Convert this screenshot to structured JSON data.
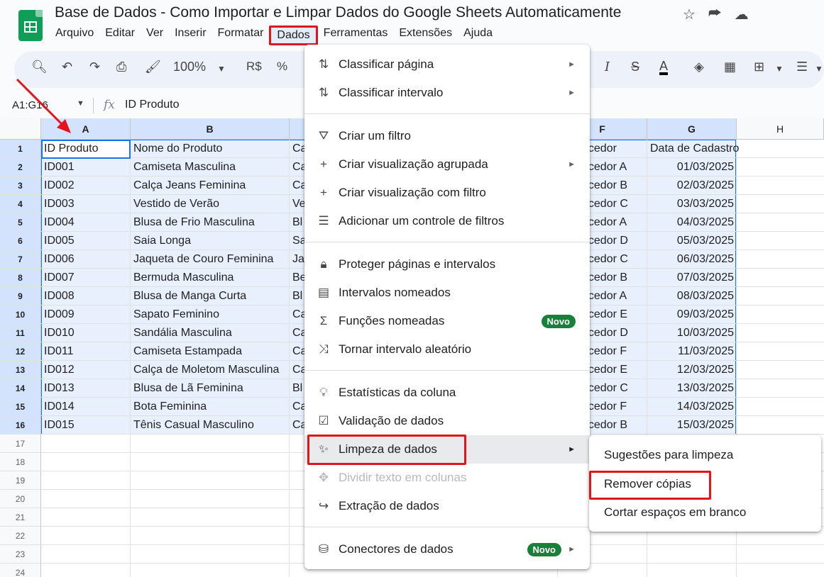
{
  "app": {
    "title": "Base de Dados - Como Importar e Limpar Dados do Google Sheets Automaticamente",
    "accent": "#0f9d58"
  },
  "menubar": [
    "Arquivo",
    "Editar",
    "Ver",
    "Inserir",
    "Formatar",
    "Dados",
    "Ferramentas",
    "Extensões",
    "Ajuda"
  ],
  "menubar_active": "Dados",
  "toolbar": {
    "zoom": "100%",
    "currency": "R$",
    "percent": "%"
  },
  "formula_bar": {
    "name_box": "A1:G16",
    "fx": "fx",
    "value": "ID Produto"
  },
  "columns": [
    "A",
    "B",
    "",
    "",
    "",
    "F",
    "G",
    "H"
  ],
  "rows": [
    "1",
    "2",
    "3",
    "4",
    "5",
    "6",
    "7",
    "8",
    "9",
    "10",
    "11",
    "12",
    "13",
    "14",
    "15",
    "16",
    "17",
    "18",
    "19",
    "20",
    "21",
    "22",
    "23",
    "24"
  ],
  "cells": {
    "A": [
      "ID Produto",
      "ID001",
      "ID002",
      "ID003",
      "ID004",
      "ID005",
      "ID006",
      "ID007",
      "ID008",
      "ID009",
      "ID010",
      "ID011",
      "ID012",
      "ID013",
      "ID014",
      "ID015"
    ],
    "B": [
      "Nome do Produto",
      "Camiseta Masculina",
      "Calça Jeans Feminina",
      "Vestido de Verão",
      "Blusa de Frio Masculina",
      "Saia Longa",
      "Jaqueta de Couro Feminina",
      "Bermuda Masculina",
      "Blusa de Manga Curta",
      "Sapato Feminino",
      "Sandália Masculina",
      "Camiseta Estampada",
      "Calça de Moletom Masculina",
      "Blusa de Lã Feminina",
      "Bota Feminina",
      "Tênis Casual Masculino"
    ],
    "C": [
      "Ca",
      "Ca",
      "Ca",
      "Ve",
      "Bl",
      "Sa",
      "Ja",
      "Be",
      "Bl",
      "Ca",
      "Ca",
      "Ca",
      "Ca",
      "Bl",
      "Ca",
      "Ca"
    ],
    "F": [
      "ecedor",
      "ecedor A",
      "ecedor B",
      "ecedor C",
      "ecedor A",
      "ecedor D",
      "ecedor C",
      "ecedor B",
      "ecedor A",
      "ecedor E",
      "ecedor D",
      "ecedor F",
      "ecedor E",
      "ecedor C",
      "ecedor F",
      "ecedor B"
    ],
    "G": [
      "Data de Cadastro",
      "01/03/2025",
      "02/03/2025",
      "03/03/2025",
      "04/03/2025",
      "05/03/2025",
      "06/03/2025",
      "07/03/2025",
      "08/03/2025",
      "09/03/2025",
      "10/03/2025",
      "11/03/2025",
      "12/03/2025",
      "13/03/2025",
      "14/03/2025",
      "15/03/2025"
    ]
  },
  "menu": {
    "items": [
      {
        "icon": "sort-icon",
        "label": "Classificar página",
        "submenu": true
      },
      {
        "icon": "sort-icon",
        "label": "Classificar intervalo",
        "submenu": true
      },
      {
        "icon": "filter-icon",
        "label": "Criar um filtro"
      },
      {
        "icon": "plus-icon",
        "label": "Criar visualização agrupada",
        "submenu": true
      },
      {
        "icon": "plus-icon",
        "label": "Criar visualização com filtro"
      },
      {
        "icon": "filter-lines-icon",
        "label": "Adicionar um controle de filtros"
      },
      {
        "icon": "lock-icon",
        "label": "Proteger páginas e intervalos"
      },
      {
        "icon": "named-ranges-icon",
        "label": "Intervalos nomeados"
      },
      {
        "icon": "sigma-icon",
        "label": "Funções nomeadas",
        "badge": "Novo"
      },
      {
        "icon": "shuffle-icon",
        "label": "Tornar intervalo aleatório"
      },
      {
        "icon": "lightbulb-icon",
        "label": "Estatísticas da coluna"
      },
      {
        "icon": "validation-icon",
        "label": "Validação de dados"
      },
      {
        "icon": "magic-wand-icon",
        "label": "Limpeza de dados",
        "submenu": true
      },
      {
        "icon": "split-icon",
        "label": "Dividir texto em colunas",
        "disabled": true
      },
      {
        "icon": "extract-icon",
        "label": "Extração de dados"
      },
      {
        "icon": "database-icon",
        "label": "Conectores de dados",
        "badge": "Novo",
        "submenu": true
      }
    ]
  },
  "submenu": {
    "items": [
      "Sugestões para limpeza",
      "Remover cópias",
      "Cortar espaços em branco"
    ]
  },
  "colors": {
    "highlight": "#e0161d",
    "selection": "#e8f0fe",
    "badge": "#188038"
  }
}
